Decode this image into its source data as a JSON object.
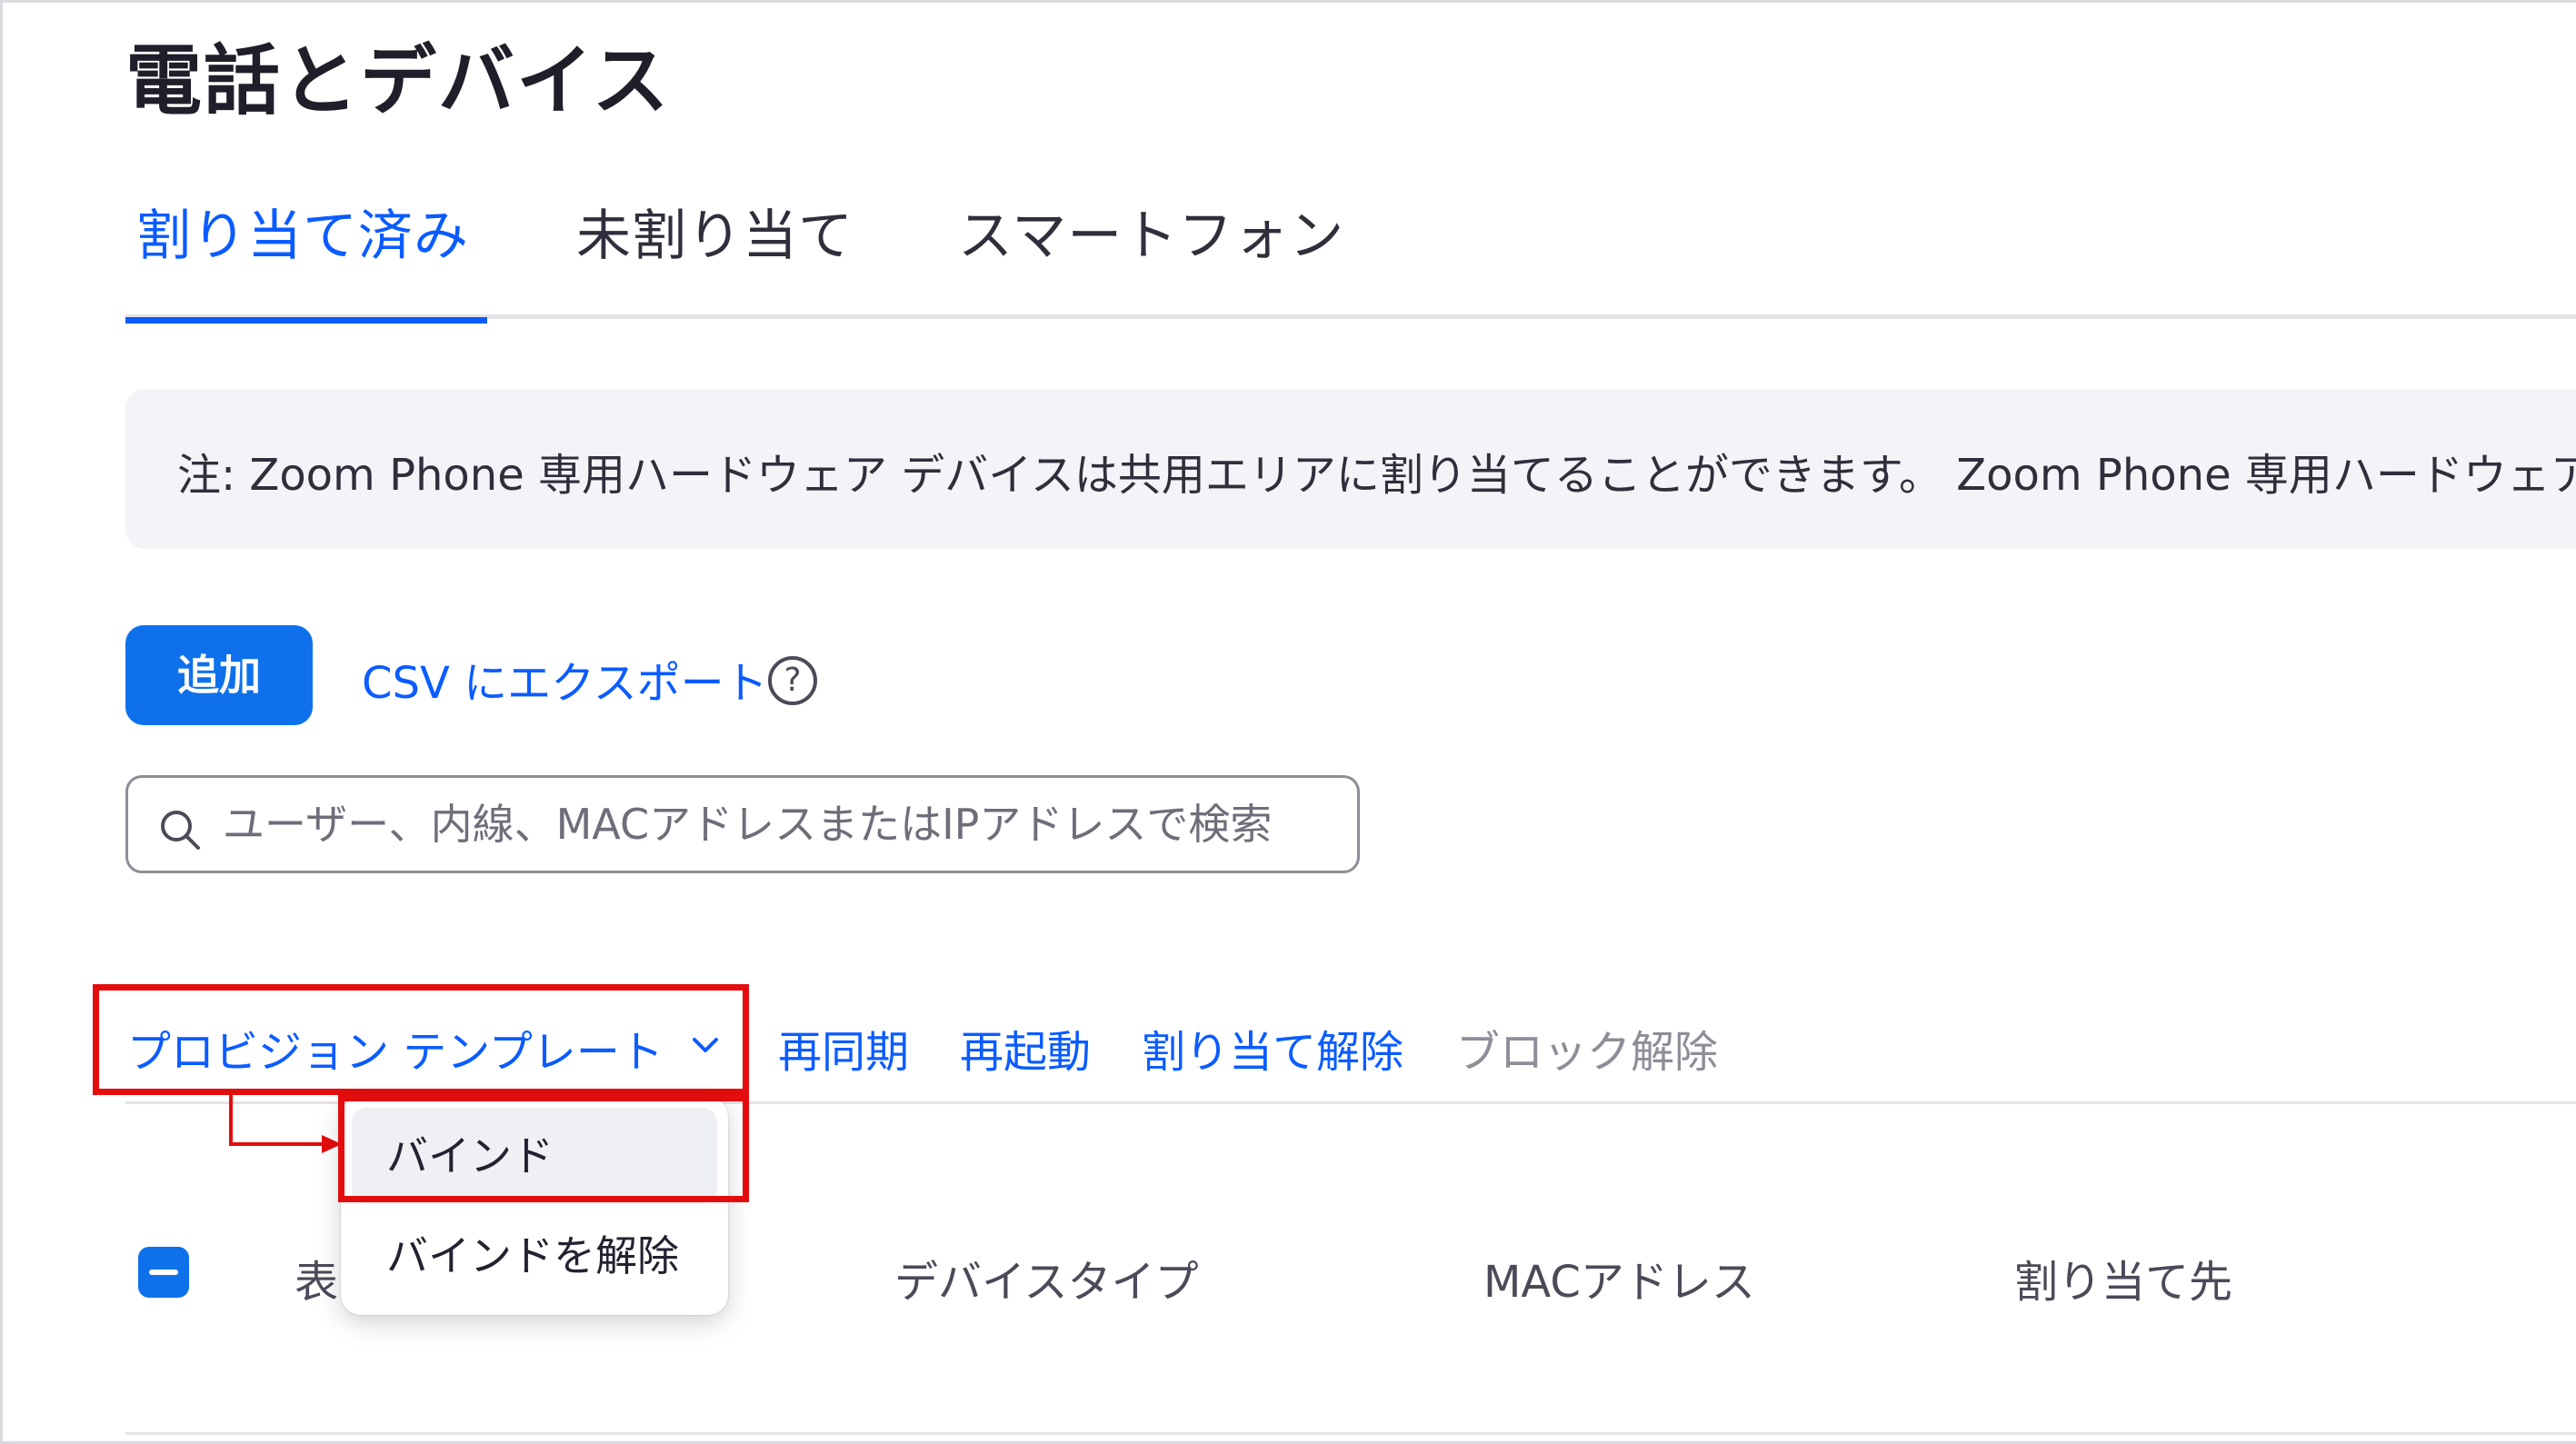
{
  "page": {
    "title": "電話とデバイス"
  },
  "tabs": [
    {
      "label": "割り当て済み",
      "active": true
    },
    {
      "label": "未割り当て",
      "active": false
    },
    {
      "label": "スマートフォン",
      "active": false
    }
  ],
  "notice": {
    "text": "注: Zoom Phone 専用ハードウェア デバイスは共用エリアに割り当てることができます。 Zoom Phone 専用ハードウェアを"
  },
  "toolbar": {
    "add_label": "追加",
    "export_label": "CSV にエクスポート",
    "help_glyph": "?"
  },
  "search": {
    "placeholder": "ユーザー、内線、MACアドレスまたはIPアドレスで検索"
  },
  "actions": {
    "provision_template": "プロビジョン テンプレート",
    "resync": "再同期",
    "restart": "再起動",
    "unassign": "割り当て解除",
    "unblock": "ブロック解除"
  },
  "dropdown": {
    "items": [
      {
        "label": "バインド"
      },
      {
        "label": "バインドを解除"
      }
    ]
  },
  "table": {
    "columns": {
      "display": "表",
      "device_type": "デバイスタイプ",
      "mac_address": "MACアドレス",
      "assigned_to": "割り当て先"
    }
  },
  "colors": {
    "accent": "#0b5cff",
    "primary_button": "#0e71eb",
    "highlight": "#e40d0d"
  }
}
